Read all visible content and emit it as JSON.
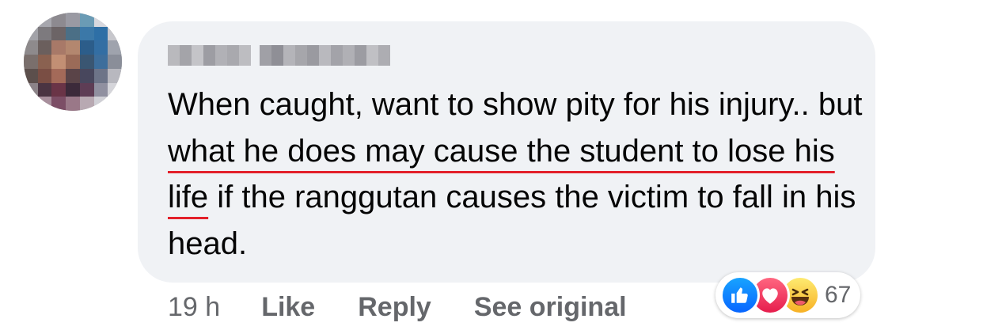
{
  "comment": {
    "text_before": "When caught, want to show pity for his injury.. but ",
    "text_underlined": "what he does may cause the student to lose his life",
    "text_after": " if the ranggutan causes the victim to fall in his head."
  },
  "actions": {
    "time": "19 h",
    "like": "Like",
    "reply": "Reply",
    "see_original": "See original"
  },
  "reactions": {
    "icons": [
      "like-icon",
      "love-icon",
      "haha-icon"
    ],
    "count": "67"
  },
  "colors": {
    "bubble": "#f0f2f5",
    "underline": "#e3202a",
    "meta_text": "#65676b",
    "like_blue": "#0866ff",
    "love_red": "#e61e4d",
    "haha_yellow": "#f7b125"
  }
}
